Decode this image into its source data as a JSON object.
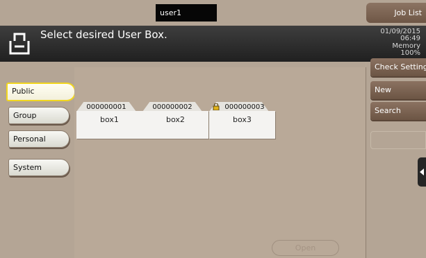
{
  "user": "user1",
  "job_list_label": "Job List",
  "header": {
    "title": "Select desired User Box.",
    "date": "01/09/2015",
    "time": "06:49",
    "memory_label": "Memory",
    "memory_value": "100%"
  },
  "tabs": [
    {
      "label": "Public",
      "active": true
    },
    {
      "label": "Group",
      "active": false
    },
    {
      "label": "Personal",
      "active": false
    },
    {
      "label": "System",
      "active": false
    }
  ],
  "boxes": [
    {
      "number": "000000001",
      "name": "box1",
      "locked": false
    },
    {
      "number": "000000002",
      "name": "box2",
      "locked": false
    },
    {
      "number": "000000003",
      "name": "box3",
      "locked": true
    }
  ],
  "open_label": "Open",
  "right_buttons": [
    {
      "label": "Check Setting"
    },
    {
      "label": "New"
    },
    {
      "label": "Search"
    }
  ],
  "colors": {
    "accent_yellow": "#f2d61e",
    "brown_button": "#7a6251",
    "background": "#b6a797"
  }
}
